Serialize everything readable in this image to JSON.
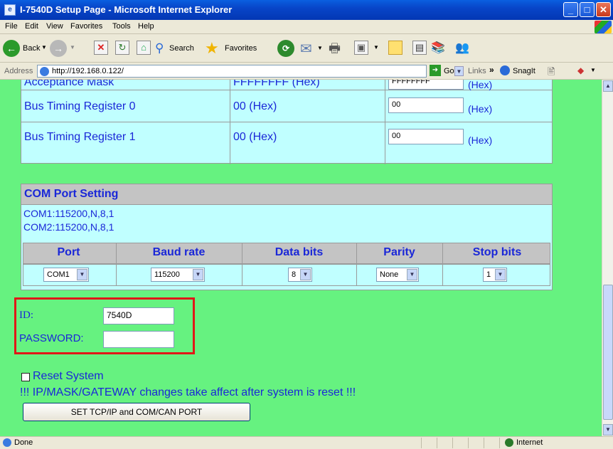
{
  "window": {
    "title": "I-7540D Setup Page - Microsoft Internet Explorer"
  },
  "menu": [
    "File",
    "Edit",
    "View",
    "Favorites",
    "Tools",
    "Help"
  ],
  "toolbar": {
    "back_label": "Back",
    "search_label": "Search",
    "favorites_label": "Favorites"
  },
  "address": {
    "label": "Address",
    "url": "http://192.168.0.122/",
    "go_label": "Go",
    "links_label": "Links",
    "snagit_label": "SnagIt"
  },
  "can_table": {
    "rows": [
      {
        "label": "Acceptance Mask",
        "value": "FFFFFFFF (Hex)",
        "input": "FFFFFFFF",
        "unit": "(Hex)"
      },
      {
        "label": "Bus Timing Register 0",
        "value": "00 (Hex)",
        "input": "00",
        "unit": "(Hex)"
      },
      {
        "label": "Bus Timing Register 1",
        "value": "00 (Hex)",
        "input": "00",
        "unit": "(Hex)"
      }
    ]
  },
  "com": {
    "title": "COM Port Setting",
    "status_lines": [
      "COM1:115200,N,8,1",
      "COM2:115200,N,8,1"
    ],
    "headers": [
      "Port",
      "Baud rate",
      "Data bits",
      "Parity",
      "Stop bits"
    ],
    "selects": [
      "COM1",
      "115200",
      "8",
      "None",
      "1"
    ]
  },
  "auth": {
    "id_label": "ID:",
    "id_value": "7540D",
    "password_label": "PASSWORD:",
    "password_value": ""
  },
  "reset": {
    "label": "Reset System",
    "checked": false,
    "warning": "!!! IP/MASK/GATEWAY changes take affect after system is reset !!!",
    "submit_label": "SET TCP/IP and COM/CAN PORT"
  },
  "status": {
    "text": "Done",
    "zone": "Internet"
  },
  "colors": {
    "page_bg": "#66f280",
    "panel_bg": "#c0ffff",
    "text_blue": "#1a27d8",
    "highlight_red": "#e01818"
  }
}
